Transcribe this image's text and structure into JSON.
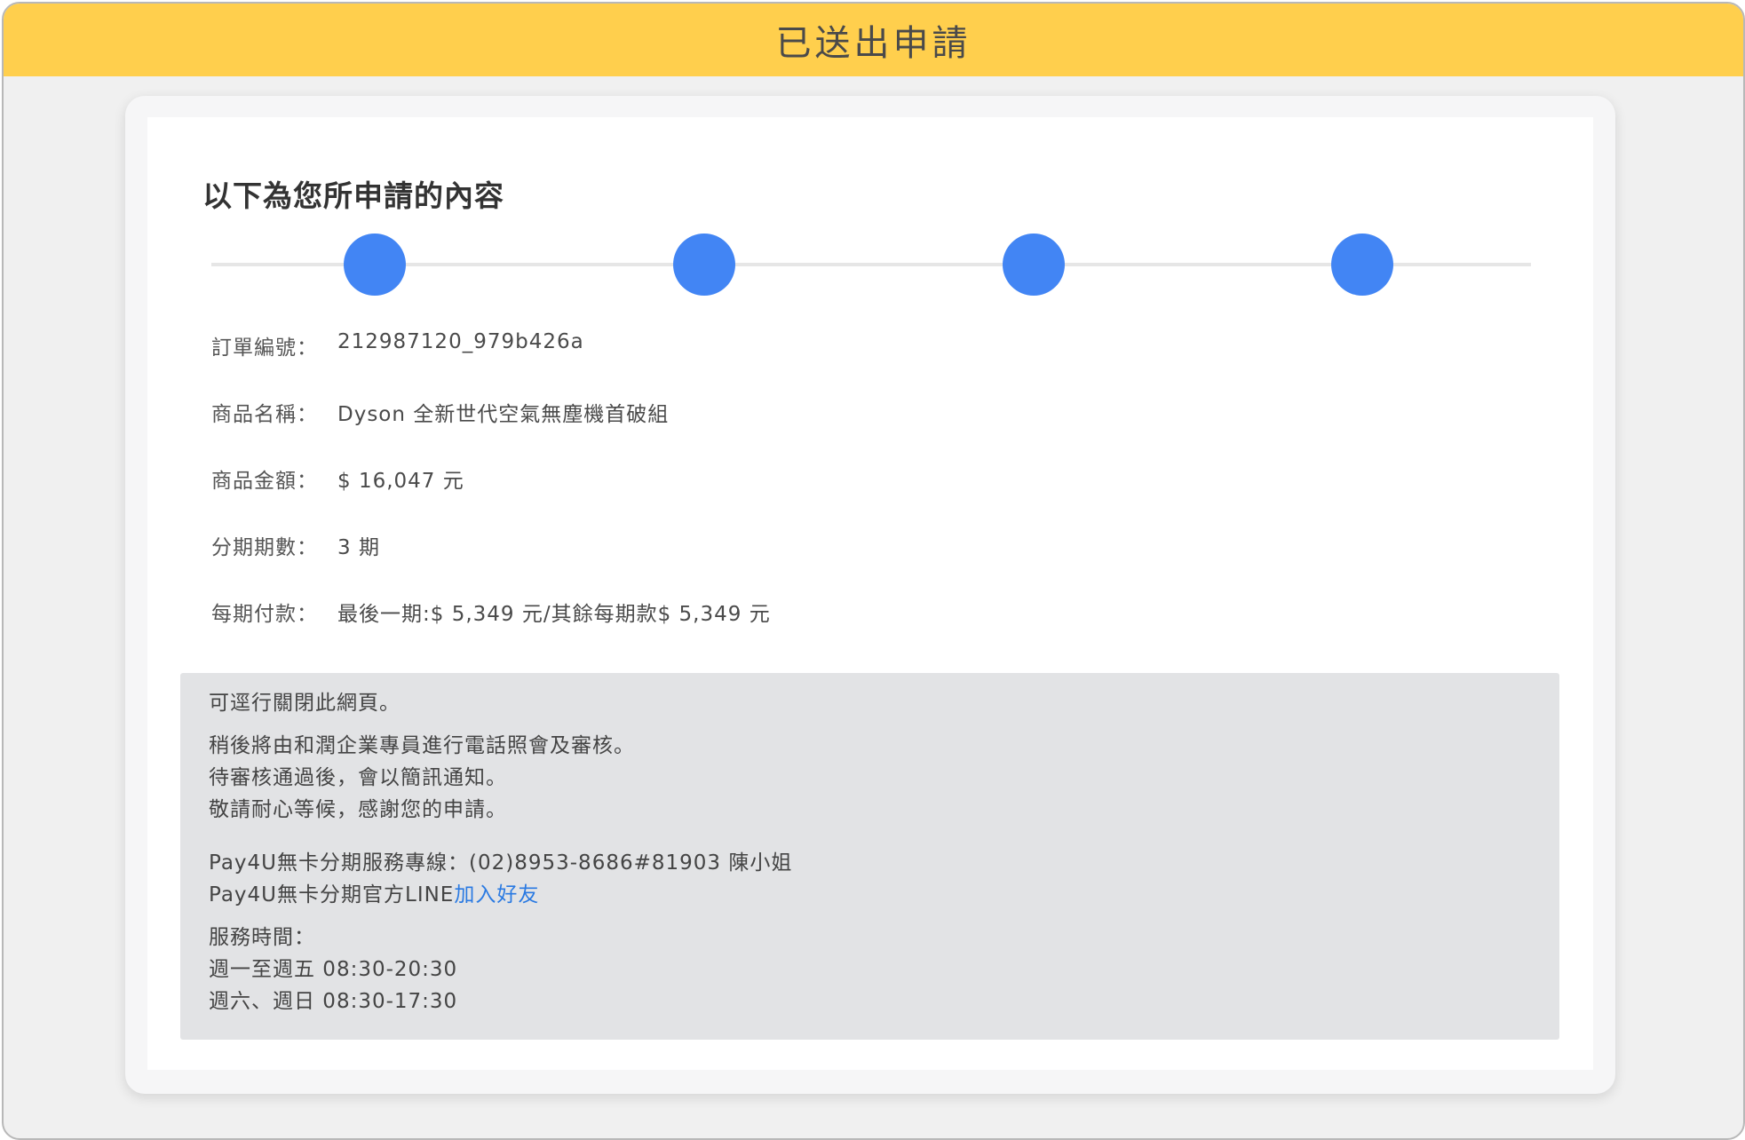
{
  "header": {
    "title": "已送出申請"
  },
  "content": {
    "title": "以下為您所申請的內容",
    "steps_count": 4,
    "fields": [
      {
        "label": "訂單編號：",
        "value": "212987120_979b426a"
      },
      {
        "label": "商品名稱：",
        "value": "Dyson 全新世代空氣無塵機首破組"
      },
      {
        "label": "商品金額：",
        "value": "$ 16,047 元"
      },
      {
        "label": "分期期數：",
        "value": "3 期"
      },
      {
        "label": "每期付款：",
        "value": "最後一期:$ 5,349 元/其餘每期款$ 5,349 元"
      }
    ]
  },
  "notice": {
    "close_hint": "可逕行關閉此網頁。",
    "messages": [
      "稍後將由和潤企業專員進行電話照會及審核。",
      "待審核通過後，會以簡訊通知。",
      "敬請耐心等候，感謝您的申請。"
    ],
    "hotline": "Pay4U無卡分期服務專線：(02)8953-8686#81903 陳小姐",
    "line_prefix": "Pay4U無卡分期官方LINE",
    "line_link": "加入好友",
    "service_hours_label": "服務時間：",
    "service_hours": [
      "週一至週五 08:30-20:30",
      "週六、週日 08:30-17:30"
    ]
  },
  "colors": {
    "header_bg": "#ffcf4d",
    "step_dot": "#4285f4",
    "notice_bg": "#e2e3e5",
    "link": "#2a7ae2"
  }
}
